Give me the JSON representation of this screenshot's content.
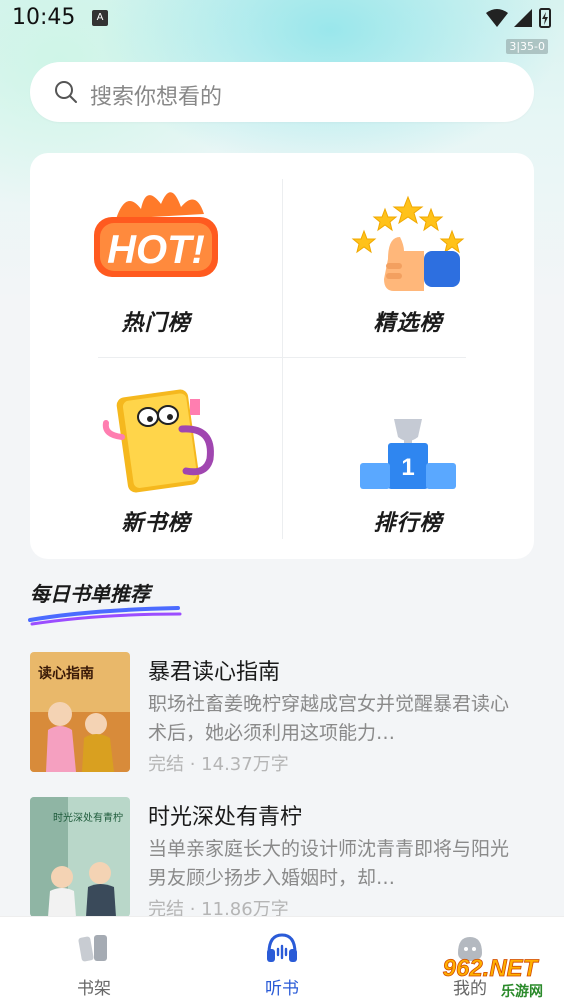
{
  "status_bar": {
    "time": "10:45",
    "notification": "A",
    "debug_tag": "3|35-0"
  },
  "search": {
    "placeholder": "搜索你想看的"
  },
  "rankings": [
    {
      "label": "热门榜",
      "icon": "hot-badge-icon",
      "art_text": "HOT!"
    },
    {
      "label": "精选榜",
      "icon": "thumbs-up-stars-icon"
    },
    {
      "label": "新书榜",
      "icon": "book-mascot-icon"
    },
    {
      "label": "排行榜",
      "icon": "podium-trophy-icon",
      "art_text": "1"
    }
  ],
  "daily": {
    "title": "每日书单推荐",
    "books": [
      {
        "title": "暴君读心指南",
        "desc": "职场社畜姜晚柠穿越成宫女并觉醒暴君读心术后，她必须利用这项能力…",
        "meta": "完结 · 14.37万字",
        "cover_text": "读心指南"
      },
      {
        "title": "时光深处有青柠",
        "desc": "当单亲家庭长大的设计师沈青青即将与阳光男友顾少扬步入婚姻时，却…",
        "meta": "完结 · 11.86万字",
        "cover_text": "时光深处有青柠"
      }
    ]
  },
  "tabs": [
    {
      "label": "书架",
      "icon": "bookshelf-icon",
      "active": false
    },
    {
      "label": "听书",
      "icon": "headphones-icon",
      "active": true
    },
    {
      "label": "我的",
      "icon": "profile-icon",
      "active": false
    }
  ],
  "watermark": {
    "text": "962.NET",
    "subtext": "乐游网"
  },
  "colors": {
    "accent": "#2a5bd7",
    "hot": "#ff5a1f"
  }
}
